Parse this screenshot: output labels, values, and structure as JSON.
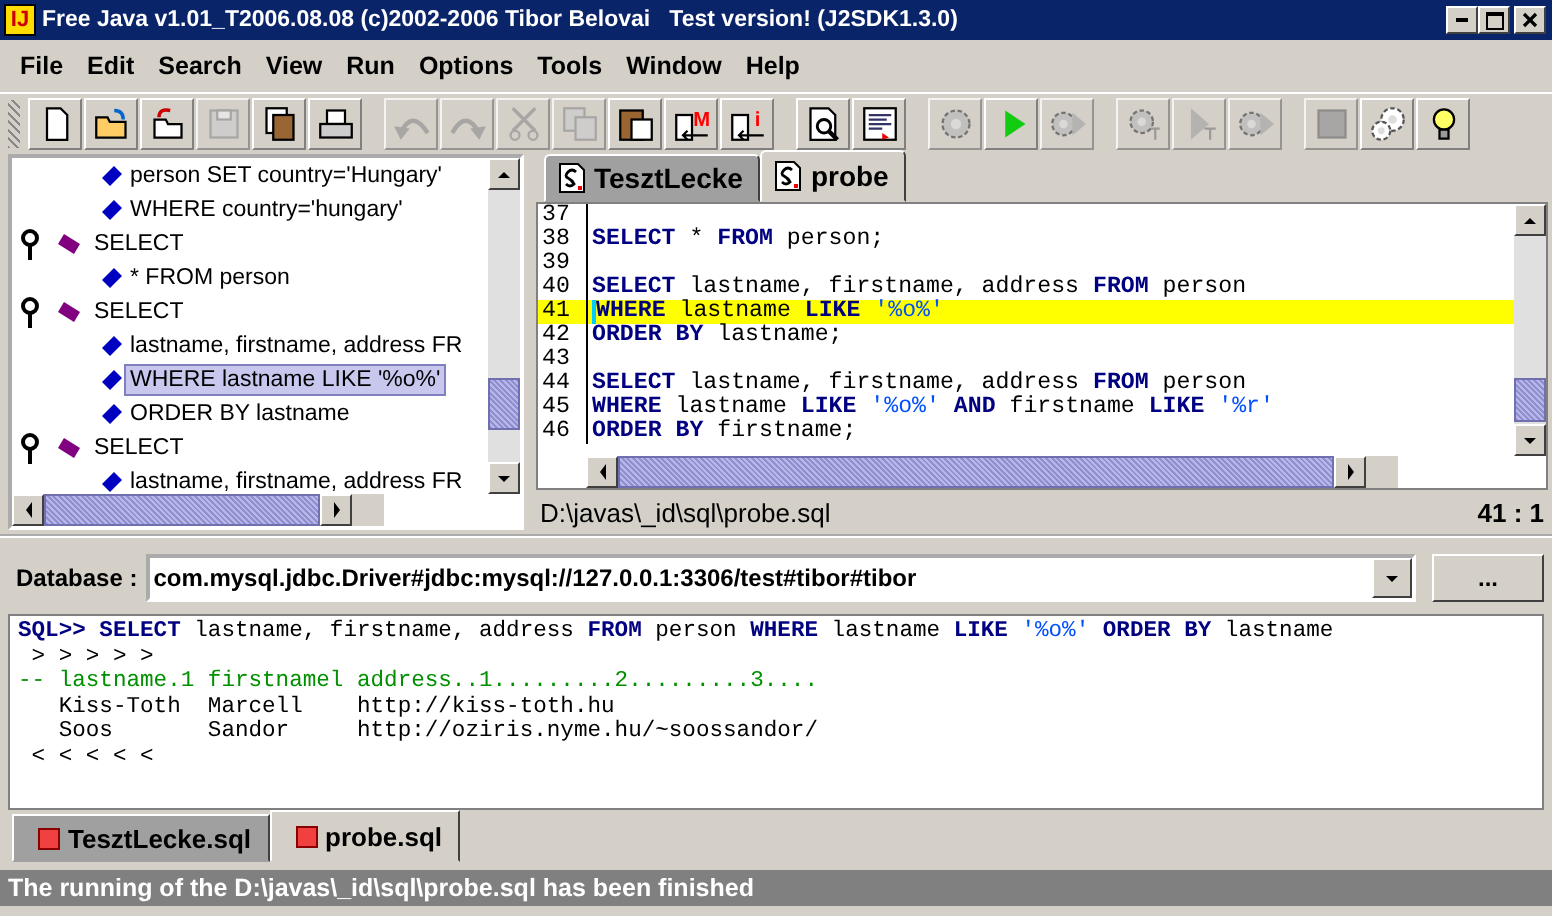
{
  "window": {
    "app_icon_text": "IJ",
    "title": "Free Java v1.01_T2006.08.08 (c)2002-2006 Tibor Belovai   Test version! (J2SDK1.3.0)"
  },
  "menu": [
    "File",
    "Edit",
    "Search",
    "View",
    "Run",
    "Options",
    "Tools",
    "Window",
    "Help"
  ],
  "toolbar": [
    {
      "kind": "new",
      "disabled": false
    },
    {
      "kind": "open",
      "disabled": false
    },
    {
      "kind": "reopen",
      "disabled": false
    },
    {
      "kind": "save",
      "disabled": true
    },
    {
      "kind": "save-all",
      "disabled": false
    },
    {
      "kind": "print",
      "disabled": false
    },
    {
      "kind": "sep"
    },
    {
      "kind": "undo",
      "disabled": true
    },
    {
      "kind": "redo",
      "disabled": true
    },
    {
      "kind": "cut",
      "disabled": true
    },
    {
      "kind": "copy",
      "disabled": true
    },
    {
      "kind": "paste",
      "disabled": false
    },
    {
      "kind": "insert",
      "letter": "M",
      "disabled": false
    },
    {
      "kind": "insert",
      "letter": "i",
      "disabled": false
    },
    {
      "kind": "sep"
    },
    {
      "kind": "preview",
      "disabled": false
    },
    {
      "kind": "browser",
      "disabled": false
    },
    {
      "kind": "sep"
    },
    {
      "kind": "gear",
      "disabled": true
    },
    {
      "kind": "run",
      "disabled": false
    },
    {
      "kind": "run-all",
      "disabled": true
    },
    {
      "kind": "sep"
    },
    {
      "kind": "gear-step",
      "disabled": true
    },
    {
      "kind": "step",
      "disabled": true
    },
    {
      "kind": "gear-step2",
      "disabled": true
    },
    {
      "kind": "sep"
    },
    {
      "kind": "stop",
      "disabled": true
    },
    {
      "kind": "settings",
      "disabled": false
    },
    {
      "kind": "tip",
      "disabled": false
    }
  ],
  "tree": [
    {
      "children": [
        {
          "label": "person SET country='Hungary'",
          "selected": false
        },
        {
          "label": "WHERE country='hungary'",
          "selected": false
        }
      ]
    },
    {
      "label": "SELECT",
      "expanded": true,
      "children": [
        {
          "label": "* FROM person",
          "selected": false
        }
      ]
    },
    {
      "label": "SELECT",
      "expanded": true,
      "children": [
        {
          "label": "lastname, firstname, address FR",
          "selected": false
        },
        {
          "label": "WHERE lastname LIKE '%o%'",
          "selected": true
        },
        {
          "label": "ORDER BY lastname",
          "selected": false
        }
      ]
    },
    {
      "label": "SELECT",
      "expanded": true,
      "children": [
        {
          "label": "lastname, firstname, address FR",
          "selected": false
        }
      ]
    }
  ],
  "editor_tabs": [
    {
      "label": "TesztLecke",
      "selected": false
    },
    {
      "label": "probe",
      "selected": true
    }
  ],
  "code": [
    {
      "number": "37",
      "current": false
    },
    {
      "number": "38",
      "current": false,
      "segments": [
        {
          "kind": "kw",
          "text": "SELECT"
        },
        {
          "kind": "plain",
          "text": " * "
        },
        {
          "kind": "kw",
          "text": "FROM"
        },
        {
          "kind": "plain",
          "text": " person;"
        }
      ]
    },
    {
      "number": "39",
      "current": false
    },
    {
      "number": "40",
      "current": false,
      "segments": [
        {
          "kind": "kw",
          "text": "SELECT"
        },
        {
          "kind": "plain",
          "text": " lastname, firstname, address "
        },
        {
          "kind": "kw",
          "text": "FROM"
        },
        {
          "kind": "plain",
          "text": " person"
        }
      ]
    },
    {
      "number": "41",
      "current": true,
      "segments": [
        {
          "kind": "kw",
          "text": "WHERE"
        },
        {
          "kind": "plain",
          "text": " lastname "
        },
        {
          "kind": "kw",
          "text": "LIKE "
        },
        {
          "kind": "str",
          "text": "'%o%'"
        }
      ]
    },
    {
      "number": "42",
      "current": false,
      "segments": [
        {
          "kind": "kw",
          "text": "ORDER BY"
        },
        {
          "kind": "plain",
          "text": " lastname;"
        }
      ]
    },
    {
      "number": "43",
      "current": false
    },
    {
      "number": "44",
      "current": false,
      "segments": [
        {
          "kind": "kw",
          "text": "SELECT"
        },
        {
          "kind": "plain",
          "text": " lastname, firstname, address "
        },
        {
          "kind": "kw",
          "text": "FROM"
        },
        {
          "kind": "plain",
          "text": " person"
        }
      ]
    },
    {
      "number": "45",
      "current": false,
      "segments": [
        {
          "kind": "kw",
          "text": "WHERE"
        },
        {
          "kind": "plain",
          "text": " lastname "
        },
        {
          "kind": "kw",
          "text": "LIKE "
        },
        {
          "kind": "str",
          "text": "'%o%'"
        },
        {
          "kind": "kw",
          "text": " AND"
        },
        {
          "kind": "plain",
          "text": " firstname "
        },
        {
          "kind": "kw",
          "text": "LIKE "
        },
        {
          "kind": "str",
          "text": "'%r'"
        }
      ]
    },
    {
      "number": "46",
      "current": false,
      "segments": [
        {
          "kind": "kw",
          "text": "ORDER BY"
        },
        {
          "kind": "plain",
          "text": " firstname;"
        }
      ]
    }
  ],
  "editor_status": {
    "path": "D:\\javas\\_id\\sql\\probe.sql",
    "position": "41 : 1"
  },
  "database": {
    "label": "Database :",
    "value": "com.mysql.jdbc.Driver#jdbc:mysql://127.0.0.1:3306/test#tibor#tibor",
    "button": "..."
  },
  "output": [
    [
      {
        "kind": "kw",
        "text": "SQL>> SELECT"
      },
      {
        "kind": "plain",
        "text": " lastname, firstname, address "
      },
      {
        "kind": "kw",
        "text": "FROM"
      },
      {
        "kind": "plain",
        "text": " person "
      },
      {
        "kind": "kw",
        "text": "WHERE"
      },
      {
        "kind": "plain",
        "text": " lastname "
      },
      {
        "kind": "kw",
        "text": "LIKE "
      },
      {
        "kind": "str",
        "text": "'%o%'"
      },
      {
        "kind": "kw",
        "text": " ORDER BY"
      },
      {
        "kind": "plain",
        "text": " lastname"
      }
    ],
    [
      {
        "kind": "plain",
        "text": " > > > > >"
      }
    ],
    [
      {
        "kind": "comment",
        "text": "-- lastname.1 firstnamel address..1.........2.........3...."
      }
    ],
    [
      {
        "kind": "plain",
        "text": "   Kiss-Toth  Marcell    http://kiss-toth.hu"
      }
    ],
    [
      {
        "kind": "plain",
        "text": "   Soos       Sandor     http://oziris.nyme.hu/~soossandor/"
      }
    ],
    [
      {
        "kind": "plain",
        "text": " < < < < <"
      }
    ]
  ],
  "output_tabs": [
    {
      "label": "TesztLecke.sql",
      "selected": false
    },
    {
      "label": "probe.sql",
      "selected": true
    }
  ],
  "status_bar": "The running of the D:\\javas\\_id\\sql\\probe.sql has been finished"
}
